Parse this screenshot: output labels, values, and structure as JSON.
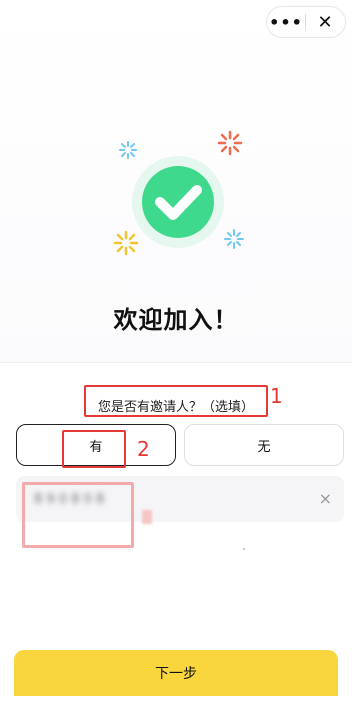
{
  "header": {
    "more_label": "•••",
    "close_label": "✕"
  },
  "hero": {
    "accent": "#3ED98D",
    "ring": "#E6F7EF",
    "spark_colors": [
      "#6EC8F0",
      "#F26B4F",
      "#F2C52E"
    ]
  },
  "welcome_title": "欢迎加入！",
  "question_label": "您是否有邀请人？（选填）",
  "options": {
    "yes_label": "有",
    "no_label": "无"
  },
  "inviter_input": {
    "value": "8 9 0 8 0 8",
    "clear_label": "×"
  },
  "next_button_label": "下一步",
  "annotations": {
    "label_1": "1",
    "label_2": "2",
    "color": "#E53935"
  }
}
